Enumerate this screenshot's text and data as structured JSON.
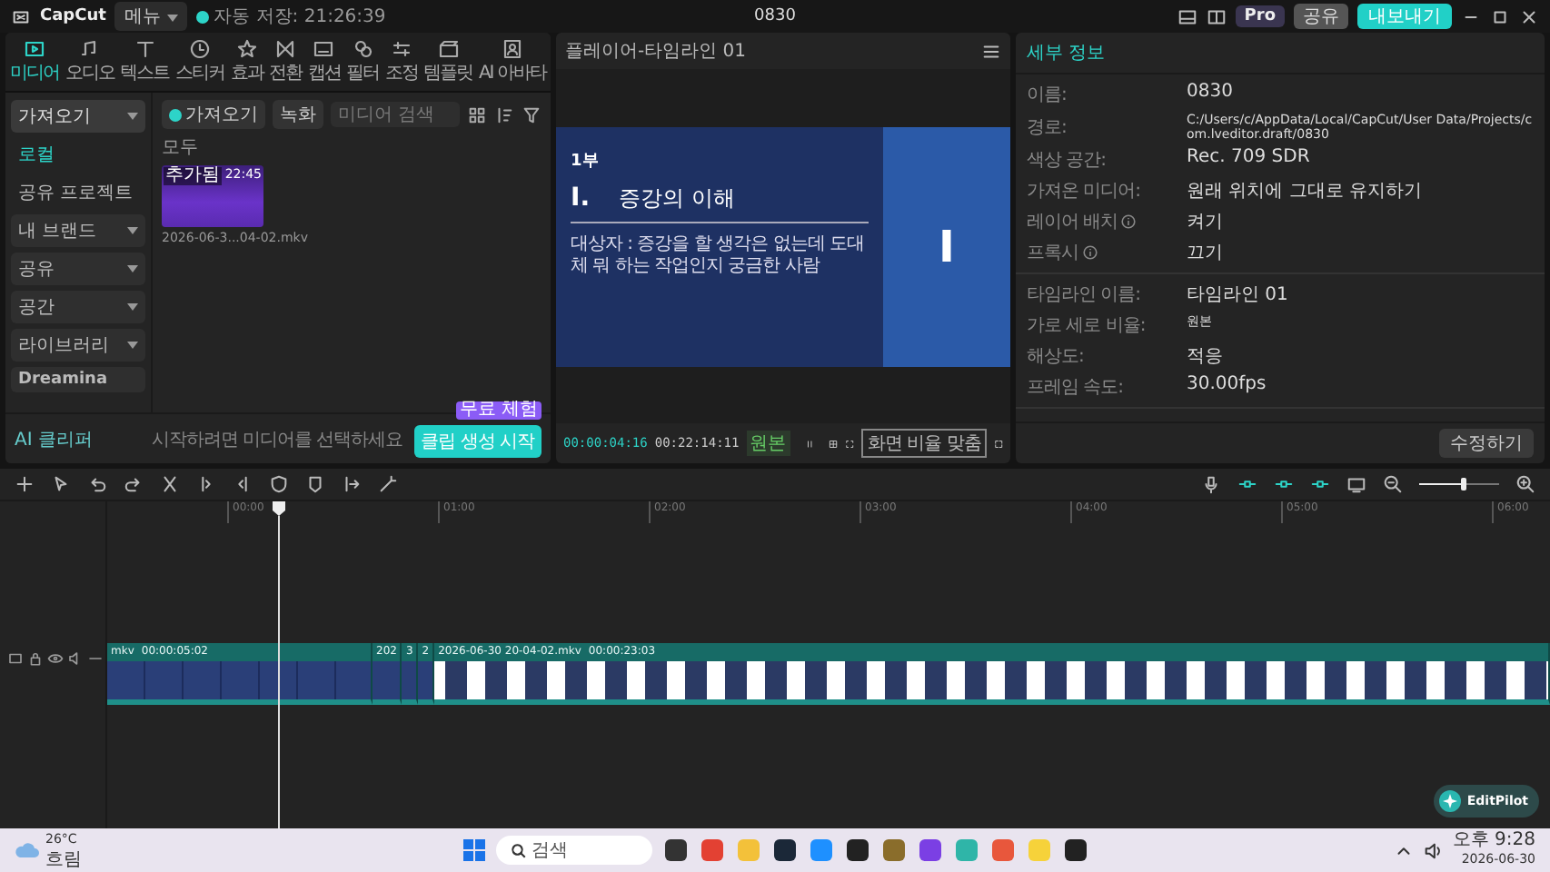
{
  "app": {
    "logo": "CapCut",
    "menu": "메뉴",
    "autosave": "자동 저장: 21:26:39",
    "title": "0830",
    "pro": "Pro",
    "share": "공유",
    "export": "내보내기"
  },
  "tool_tabs": [
    {
      "label": "미디어",
      "selected": true
    },
    {
      "label": "오디오",
      "selected": false
    },
    {
      "label": "텍스트",
      "selected": false
    },
    {
      "label": "스티커",
      "selected": false
    },
    {
      "label": "효과",
      "selected": false
    },
    {
      "label": "전환",
      "selected": false
    },
    {
      "label": "캡션",
      "selected": false
    },
    {
      "label": "필터",
      "selected": false
    },
    {
      "label": "조정",
      "selected": false
    },
    {
      "label": "템플릿",
      "selected": false
    },
    {
      "label": "AI 아바타",
      "selected": false
    }
  ],
  "sidebar": {
    "items": [
      {
        "kind": "dropdown",
        "label": "가져오기",
        "selected": true
      },
      {
        "kind": "link",
        "label": "로컬",
        "selected": true
      },
      {
        "kind": "link",
        "label": "공유 프로젝트",
        "selected": false
      },
      {
        "kind": "dropdown",
        "label": "내 브랜드",
        "selected": false
      },
      {
        "kind": "dropdown",
        "label": "공유",
        "selected": false
      },
      {
        "kind": "dropdown",
        "label": "공간",
        "selected": false
      },
      {
        "kind": "dropdown",
        "label": "라이브러리",
        "selected": false
      },
      {
        "kind": "plain",
        "label": "Dreamina",
        "selected": false
      }
    ]
  },
  "media": {
    "import": "가져오기",
    "record": "녹화",
    "search_placeholder": "미디어 검색",
    "filter": "모두",
    "clips": [
      {
        "badge": "추가됨",
        "duration": "22:45",
        "filename": "2026-06-3...04-02.mkv"
      }
    ]
  },
  "ai_clipper": {
    "label": "AI 클리퍼",
    "hint": "시작하려면 미디어를 선택하세요",
    "button": "클립 생성 시작",
    "promo": "무료 체험"
  },
  "player": {
    "title": "플레이어-타임라인 01",
    "slide": {
      "part": "1부",
      "numeral": "I.",
      "heading": "증강의 이해",
      "body": "대상자 : 증강을 할 생각은 없는데 도대체 뭐 하는 작업인지 궁금한 사람",
      "side": "I"
    },
    "current": "00:00:04:16",
    "total": "00:22:14:11",
    "quality": "원본",
    "playing": true,
    "ratio": "화면 비율 맞춤"
  },
  "details": {
    "title": "세부 정보",
    "sections": [
      {
        "rows": [
          {
            "label": "이름:",
            "value": "0830",
            "info": false
          },
          {
            "label": "경로:",
            "value": "C:/Users/c/AppData/Local/CapCut/User Data/Projects/com.lveditor.draft/0830",
            "info": false
          },
          {
            "label": "색상 공간:",
            "value": "Rec. 709 SDR",
            "info": false
          },
          {
            "label": "가져온 미디어:",
            "value": "원래 위치에 그대로 유지하기",
            "info": false
          },
          {
            "label": "레이어 배치",
            "value": "켜기",
            "info": true
          },
          {
            "label": "프록시",
            "value": "끄기",
            "info": true
          }
        ]
      },
      {
        "rows": [
          {
            "label": "타임라인 이름:",
            "value": "타임라인 01",
            "info": false
          },
          {
            "label": "가로 세로 비율:",
            "value": "원본",
            "info": false
          },
          {
            "label": "해상도:",
            "value": "적응",
            "info": false
          },
          {
            "label": "프레임 속도:",
            "value": "30.00fps",
            "info": false
          }
        ]
      }
    ],
    "edit": "수정하기"
  },
  "timeline": {
    "zoom": {
      "level": 0.55
    },
    "ruler": [
      "00:00",
      "01:00",
      "02:00",
      "03:00",
      "04:00",
      "05:00",
      "06:00"
    ],
    "clips": [
      {
        "kind": "wide",
        "label": "mkv",
        "duration": "00:00:05:02"
      },
      {
        "kind": "narrow",
        "label": "202"
      },
      {
        "kind": "narrow",
        "label": "3"
      },
      {
        "kind": "narrow",
        "label": "2"
      },
      {
        "kind": "fill",
        "label": "2026-06-30 20-04-02.mkv",
        "duration": "00:00:23:03"
      }
    ]
  },
  "editpilot": "EditPilot",
  "taskbar": {
    "temp": "26°C",
    "weather": "흐림",
    "search": "검색",
    "time": "오후 9:28",
    "date": "2026-06-30"
  }
}
